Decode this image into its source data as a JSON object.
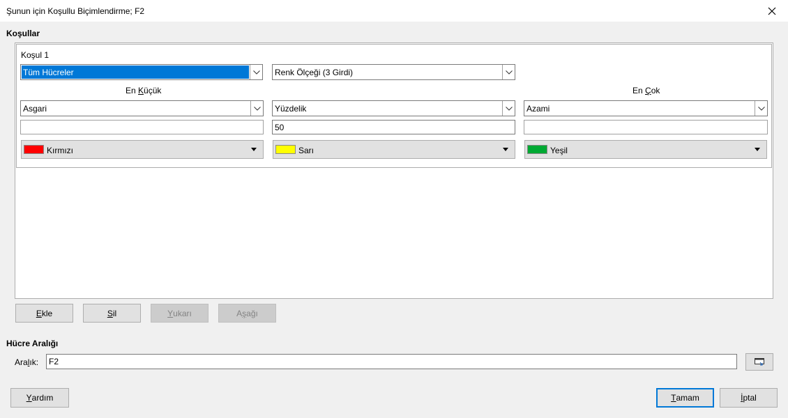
{
  "window": {
    "title": "Şunun için Koşullu Biçimlendirme; F2"
  },
  "conditions_section": {
    "title": "Koşullar"
  },
  "condition1": {
    "label": "Koşul 1",
    "applies_to": "Tüm Hücreler",
    "format_type": "Renk Ölçeği (3 Girdi)",
    "min": {
      "header": "En Küçük",
      "type": "Asgari",
      "value": "",
      "color_name": "Kırmızı",
      "color": "#ff0000"
    },
    "mid": {
      "type": "Yüzdelik",
      "value": "50",
      "color_name": "Sarı",
      "color": "#ffff00"
    },
    "max": {
      "header": "En Çok",
      "type": "Azami",
      "value": "",
      "color_name": "Yeşil",
      "color": "#00a933"
    }
  },
  "buttons": {
    "add": "Ekle",
    "delete": "Sil",
    "up": "Yukarı",
    "down": "Aşağı",
    "help": "Yardım",
    "ok": "Tamam",
    "cancel": "İptal"
  },
  "range_section": {
    "title": "Hücre Aralığı",
    "label": "Aralık:",
    "value": "F2"
  }
}
